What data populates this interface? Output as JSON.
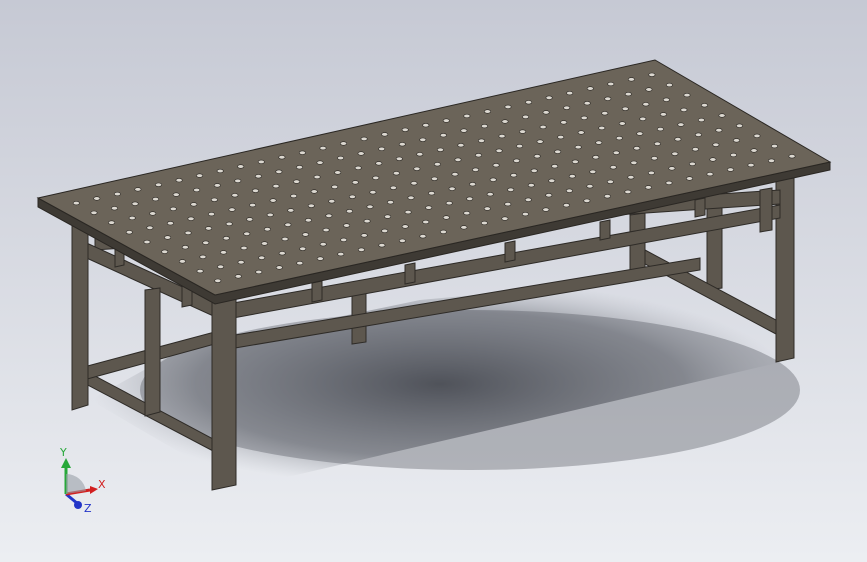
{
  "colors": {
    "background_top": "#c9ccd6",
    "background_bottom": "#eceef2",
    "steel_top": "#6b6459",
    "steel_dark": "#3e3a34",
    "steel_frame": "#5d574e",
    "hole": "#dcd8d0",
    "axis_x": "#d21f1f",
    "axis_y": "#27a83a",
    "axis_z": "#2335c8"
  },
  "triad": {
    "x_label": "X",
    "y_label": "Y",
    "z_label": "Z"
  }
}
